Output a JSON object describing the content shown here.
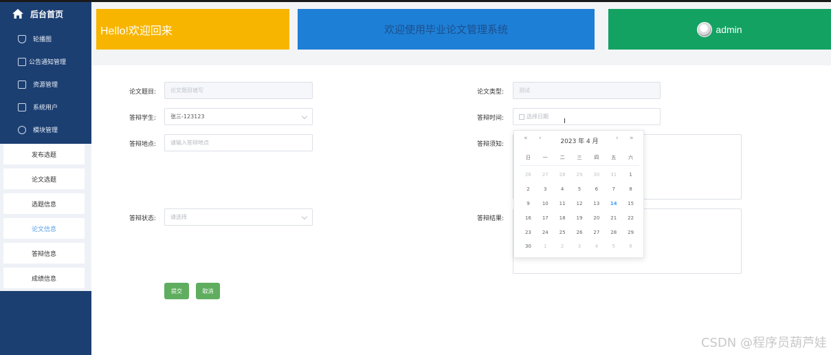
{
  "header": {
    "hello": "Hello!欢迎回来",
    "welcome": "欢迎使用毕业论文管理系统",
    "user": "admin"
  },
  "sidebar": {
    "home": "后台首页",
    "items": [
      "轮播图",
      "公告通知管理",
      "资源管理",
      "系统用户",
      "模块管理"
    ],
    "sub_items": [
      "发布选题",
      "论文选题",
      "选题信息",
      "论文信息",
      "答辩信息",
      "成绩信息"
    ],
    "active_sub": "论文信息"
  },
  "form": {
    "title_label": "论文题目:",
    "title_placeholder": "论文题目填写",
    "type_label": "论文类型:",
    "type_value": "测试",
    "student_label": "答辩学生:",
    "student_value": "张三-123123",
    "time_label": "答辩时间:",
    "time_placeholder": "选择日期",
    "place_label": "答辩地点:",
    "place_placeholder": "请输入答辩地点",
    "notice_label": "答辩须知:",
    "status_label": "答辩状态:",
    "status_placeholder": "请选择",
    "result_label": "答辩结果:",
    "submit": "提交",
    "cancel": "取消"
  },
  "datepicker": {
    "prev_year": "«",
    "prev_month": "‹",
    "next_month": "›",
    "next_year": "»",
    "title": "2023 年  4 月",
    "weekdays": [
      "日",
      "一",
      "二",
      "三",
      "四",
      "五",
      "六"
    ],
    "days": [
      {
        "d": "26",
        "m": "prev"
      },
      {
        "d": "27",
        "m": "prev"
      },
      {
        "d": "28",
        "m": "prev"
      },
      {
        "d": "29",
        "m": "prev"
      },
      {
        "d": "30",
        "m": "prev"
      },
      {
        "d": "31",
        "m": "prev"
      },
      {
        "d": "1",
        "m": "cur"
      },
      {
        "d": "2",
        "m": "cur"
      },
      {
        "d": "3",
        "m": "cur"
      },
      {
        "d": "4",
        "m": "cur"
      },
      {
        "d": "5",
        "m": "cur"
      },
      {
        "d": "6",
        "m": "cur"
      },
      {
        "d": "7",
        "m": "cur"
      },
      {
        "d": "8",
        "m": "cur"
      },
      {
        "d": "9",
        "m": "cur"
      },
      {
        "d": "10",
        "m": "cur"
      },
      {
        "d": "11",
        "m": "cur"
      },
      {
        "d": "12",
        "m": "cur"
      },
      {
        "d": "13",
        "m": "cur"
      },
      {
        "d": "14",
        "m": "today"
      },
      {
        "d": "15",
        "m": "cur"
      },
      {
        "d": "16",
        "m": "cur"
      },
      {
        "d": "17",
        "m": "cur"
      },
      {
        "d": "18",
        "m": "cur"
      },
      {
        "d": "19",
        "m": "cur"
      },
      {
        "d": "20",
        "m": "cur"
      },
      {
        "d": "21",
        "m": "cur"
      },
      {
        "d": "22",
        "m": "cur"
      },
      {
        "d": "23",
        "m": "cur"
      },
      {
        "d": "24",
        "m": "cur"
      },
      {
        "d": "25",
        "m": "cur"
      },
      {
        "d": "26",
        "m": "cur"
      },
      {
        "d": "27",
        "m": "cur"
      },
      {
        "d": "28",
        "m": "cur"
      },
      {
        "d": "29",
        "m": "cur"
      },
      {
        "d": "30",
        "m": "cur"
      },
      {
        "d": "1",
        "m": "next"
      },
      {
        "d": "2",
        "m": "next"
      },
      {
        "d": "3",
        "m": "next"
      },
      {
        "d": "4",
        "m": "next"
      },
      {
        "d": "5",
        "m": "next"
      },
      {
        "d": "6",
        "m": "next"
      }
    ]
  },
  "watermark": "CSDN @程序员葫芦娃",
  "colors": {
    "sidebar": "#1c3f72",
    "hello_card": "#f7b500",
    "welcome_card": "#1e7fd6",
    "user_card": "#13a262",
    "button": "#5fae5f",
    "today": "#409eff"
  }
}
